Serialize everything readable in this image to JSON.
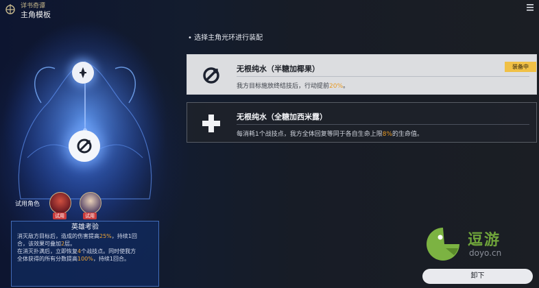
{
  "header": {
    "subtitle": "详书奇谭",
    "title": "主角模板"
  },
  "left": {
    "trial_label": "试用角色",
    "trial_tags": [
      "试用",
      "试用"
    ],
    "hero_panel": {
      "title": "英雄考验",
      "line1_a": "消灭敌方目标后，造成的伤害提高",
      "line1_b": "25%",
      "line1_c": "，持续1回",
      "line2_a": "合，该效果可叠加",
      "line2_b": "2",
      "line2_c": "层。",
      "line3_a": "在消灭扑满后，立即恢复",
      "line3_b": "4",
      "line3_c": "个战技点。同时使我方",
      "line4_a": "全体获得的所有分数提高",
      "line4_b": "100%",
      "line4_c": "，持续1回合。"
    }
  },
  "right": {
    "instruction": "• 选择主角光环进行装配",
    "options": [
      {
        "name": "无根纯水（半糖加椰果）",
        "desc_a": "我方目标施放终结技后，行动提前",
        "desc_b": "20%",
        "desc_c": "。",
        "badge": "装备中",
        "icon": "swirl-arrow-icon"
      },
      {
        "name": "无根纯水（全糖加西米露）",
        "desc_a": "每消耗1个战技点，我方全体回复等同于各自生命上限",
        "desc_b": "8%",
        "desc_c": "的生命值。",
        "icon": "plus-cross-icon"
      }
    ],
    "unequip_label": "卸下"
  },
  "watermark": {
    "cn": "逗游",
    "en": "doyo.cn"
  },
  "colors": {
    "accent_orange": "#e89a24",
    "badge_yellow": "#f0c046",
    "watermark_green": "#6fa43a"
  }
}
